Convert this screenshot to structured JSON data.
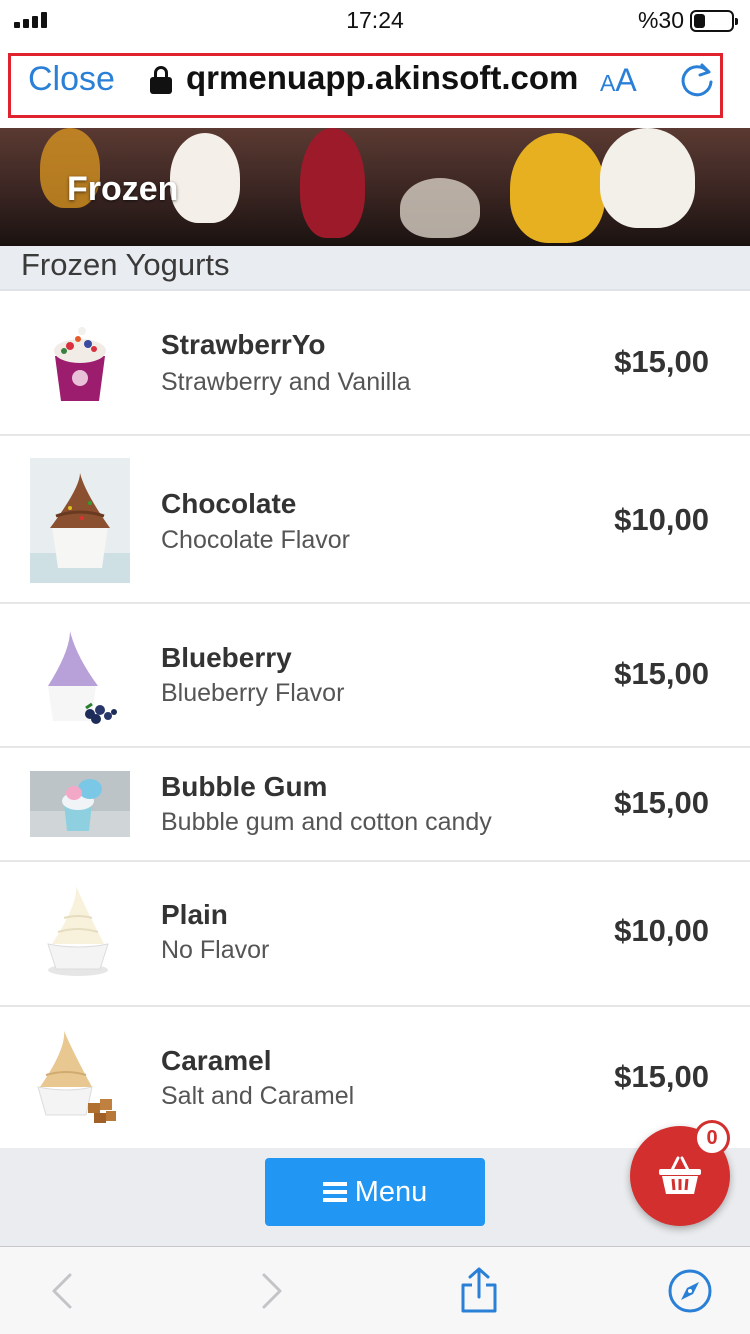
{
  "status_bar": {
    "time": "17:24",
    "battery": "%30",
    "battery_level": 0.3
  },
  "address_bar": {
    "close_label": "Close",
    "url": "qrmenuapp.akinsoft.com",
    "text_size_small": "A",
    "text_size_large": "A",
    "accent_color": "#2a7fd6"
  },
  "hero": {
    "title": "Frozen"
  },
  "section": {
    "title": "Frozen Yogurts"
  },
  "products": [
    {
      "name": "StrawberrYo",
      "description": "Strawberry and Vanilla",
      "price": "$15,00",
      "image_icon": "strawberry-yogurt-cup-image"
    },
    {
      "name": "Chocolate",
      "description": "Chocolate Flavor",
      "price": "$10,00",
      "image_icon": "chocolate-yogurt-cup-image"
    },
    {
      "name": "Blueberry",
      "description": "Blueberry Flavor",
      "price": "$15,00",
      "image_icon": "blueberry-yogurt-cup-image"
    },
    {
      "name": "Bubble Gum",
      "description": "Bubble gum and cotton candy",
      "price": "$15,00",
      "image_icon": "bubble-gum-yogurt-cup-image"
    },
    {
      "name": "Plain",
      "description": "No Flavor",
      "price": "$10,00",
      "image_icon": "plain-yogurt-cup-image"
    },
    {
      "name": "Caramel",
      "description": "Salt and Caramel",
      "price": "$15,00",
      "image_icon": "caramel-yogurt-cup-image"
    }
  ],
  "bottom": {
    "menu_label": "Menu",
    "cart_count": "0",
    "menu_color": "#2196f3",
    "cart_color": "#d32f2f"
  },
  "toolbar": {
    "icons": [
      "back-icon",
      "forward-icon",
      "share-icon",
      "compass-icon"
    ]
  }
}
